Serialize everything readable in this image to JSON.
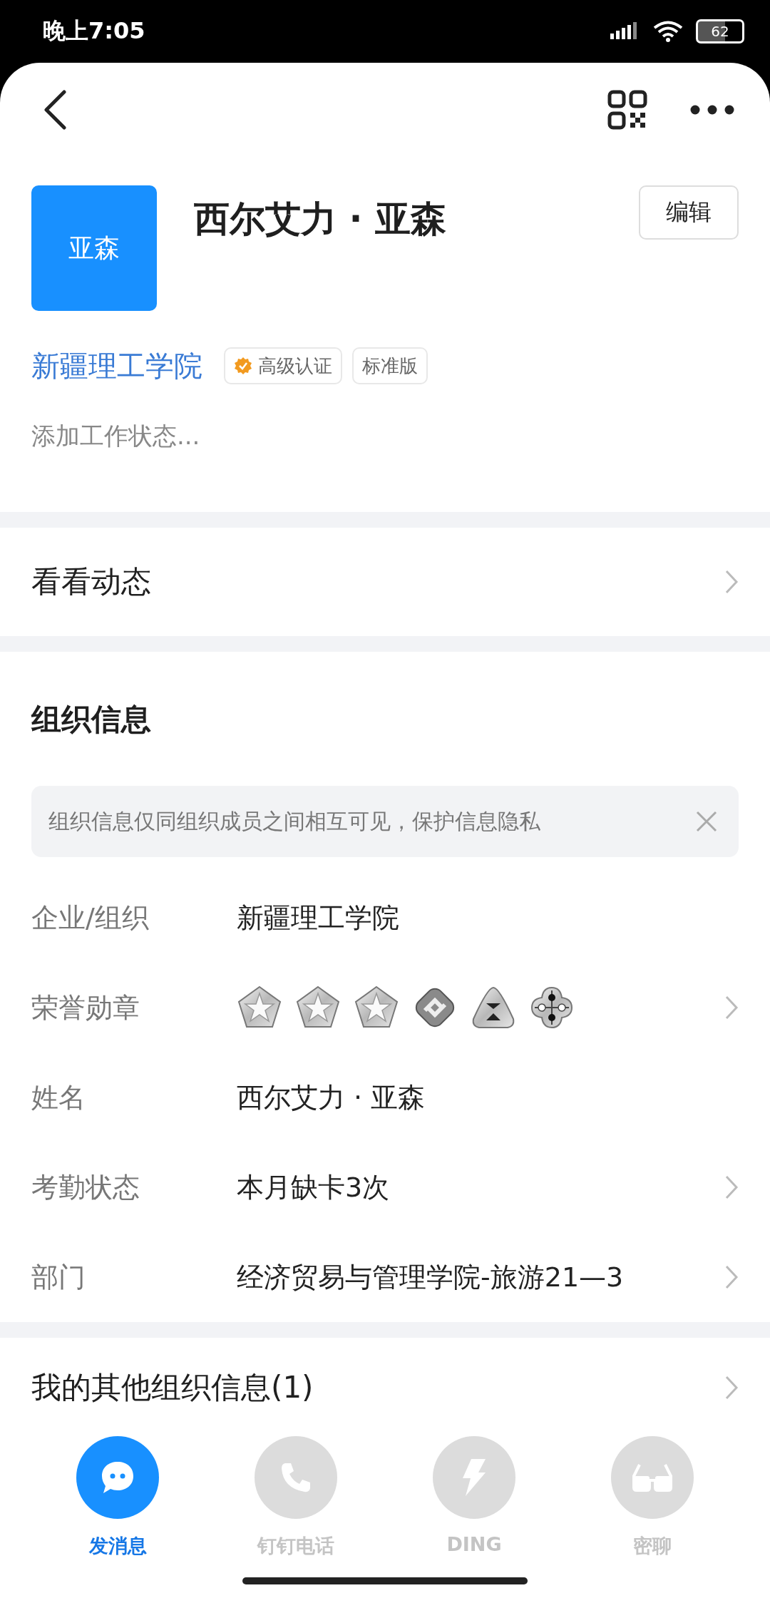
{
  "status_bar": {
    "time": "晚上7:05",
    "battery": "62"
  },
  "profile": {
    "avatar_text": "亚森",
    "name": "西尔艾力 · 亚森",
    "edit_button": "编辑",
    "organization": "新疆理工学院",
    "badges": [
      {
        "kind": "verified",
        "label": "高级认证"
      },
      {
        "kind": "plain",
        "label": "标准版"
      }
    ],
    "work_status_placeholder": "添加工作状态..."
  },
  "moments_row": {
    "label": "看看动态"
  },
  "org_info": {
    "title": "组织信息",
    "notice": "组织信息仅同组织成员之间相互可见，保护信息隐私",
    "rows": [
      {
        "kind": "text",
        "label": "企业/组织",
        "value": "新疆理工学院",
        "chevron": false
      },
      {
        "kind": "medals",
        "label": "荣誉勋章",
        "medals": [
          {
            "kind": "star"
          },
          {
            "kind": "star"
          },
          {
            "kind": "star"
          },
          {
            "kind": "knot"
          },
          {
            "kind": "triangle"
          },
          {
            "kind": "clover"
          }
        ],
        "chevron": true
      },
      {
        "kind": "text",
        "label": "姓名",
        "value": "西尔艾力 · 亚森",
        "chevron": false
      },
      {
        "kind": "text",
        "label": "考勤状态",
        "value": "本月缺卡3次",
        "chevron": true
      },
      {
        "kind": "text",
        "label": "部门",
        "value": "经济贸易与管理学院-旅游21—3",
        "chevron": true
      }
    ]
  },
  "other_orgs_row": {
    "label": "我的其他组织信息(1)"
  },
  "actions": [
    {
      "kind": "message",
      "label": "发消息",
      "disabled": false
    },
    {
      "kind": "phone",
      "label": "钉钉电话",
      "disabled": true
    },
    {
      "kind": "ding",
      "label": "DING",
      "disabled": true
    },
    {
      "kind": "secret",
      "label": "密聊",
      "disabled": true
    }
  ]
}
